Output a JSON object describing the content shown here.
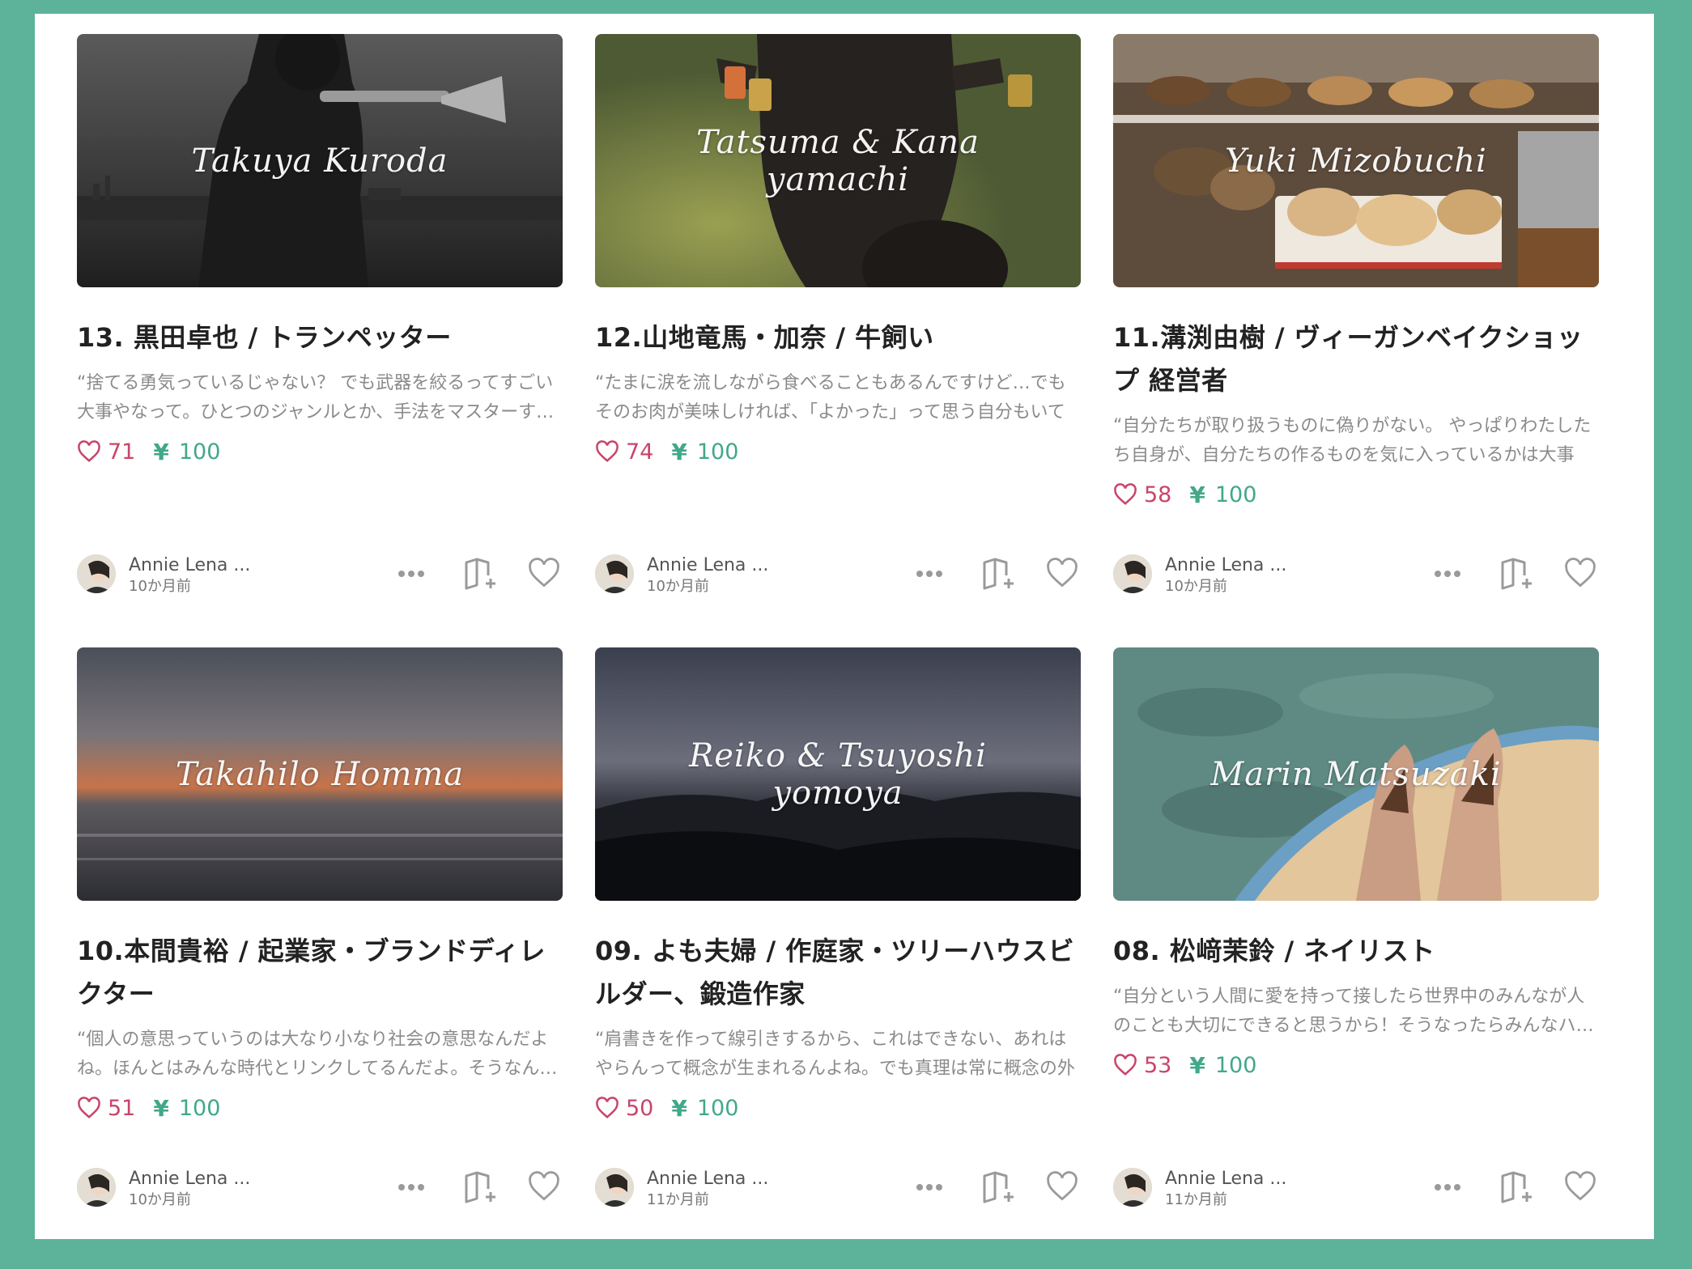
{
  "cards": [
    {
      "signature": "Takuya Kuroda",
      "title": "13. 黒田卓也 / トランペッター",
      "excerpt": "“捨てる勇気っているじゃない？ でも武器を絞るってすごい大事やなって。ひとつのジャンルとか、手法をマスターするってことは大事で",
      "likes": "71",
      "price": "100",
      "author": "Annie Lena ...",
      "date": "10か月前",
      "scene": "trumpet"
    },
    {
      "signature": "Tatsuma & Kana\nyamachi",
      "title": "12.山地竜馬・加奈 / 牛飼い",
      "excerpt": "“たまに涙を流しながら食べることもあるんですけど…でもそのお肉が美味しければ、「よかった」って思う自分もいて",
      "likes": "74",
      "price": "100",
      "author": "Annie Lena ...",
      "date": "10か月前",
      "scene": "cow"
    },
    {
      "signature": "Yuki Mizobuchi",
      "title": "11.溝渕由樹 / ヴィーガンベイクショップ 経営者",
      "excerpt": "“自分たちが取り扱うものに偽りがない。 やっぱりわたしたち自身が、自分たちの作るものを気に入っているかは大事",
      "likes": "58",
      "price": "100",
      "author": "Annie Lena ...",
      "date": "10か月前",
      "scene": "bakery"
    },
    {
      "signature": "Takahilo Homma",
      "title": "10.本間貴裕 / 起業家・ブランドディレクター",
      "excerpt": "“個人の意思っていうのは大なり小なり社会の意思なんだよね。ほんとはみんな時代とリンクしてるんだよ。そうなんだよね",
      "likes": "51",
      "price": "100",
      "author": "Annie Lena ...",
      "date": "10か月前",
      "scene": "sunset"
    },
    {
      "signature": "Reiko & Tsuyoshi\nyomoya",
      "title": "09. よも夫婦 / 作庭家・ツリーハウスビルダー、鍛造作家",
      "excerpt": "“肩書きを作って線引きするから、これはできない、あれはやらんって概念が生まれるんよね。でも真理は常に概念の外",
      "likes": "50",
      "price": "100",
      "author": "Annie Lena ...",
      "date": "11か月前",
      "scene": "islands"
    },
    {
      "signature": "Marin Matsuzaki",
      "title": "08. 松﨑茉鈴 / ネイリスト",
      "excerpt": "“自分という人間に愛を持って接したら世界中のみんなが人のことも大切にできると思うから！そうなったらみんなハッピー",
      "likes": "53",
      "price": "100",
      "author": "Annie Lena ...",
      "date": "11か月前",
      "scene": "feet"
    }
  ],
  "colors": {
    "frame": "#5db39a",
    "like": "#c9456a",
    "price": "#41a88a"
  },
  "icons": {
    "yen": "¥",
    "more": "more-horizontal-icon",
    "book": "add-to-magazine-icon",
    "heart": "heart-outline-icon"
  }
}
